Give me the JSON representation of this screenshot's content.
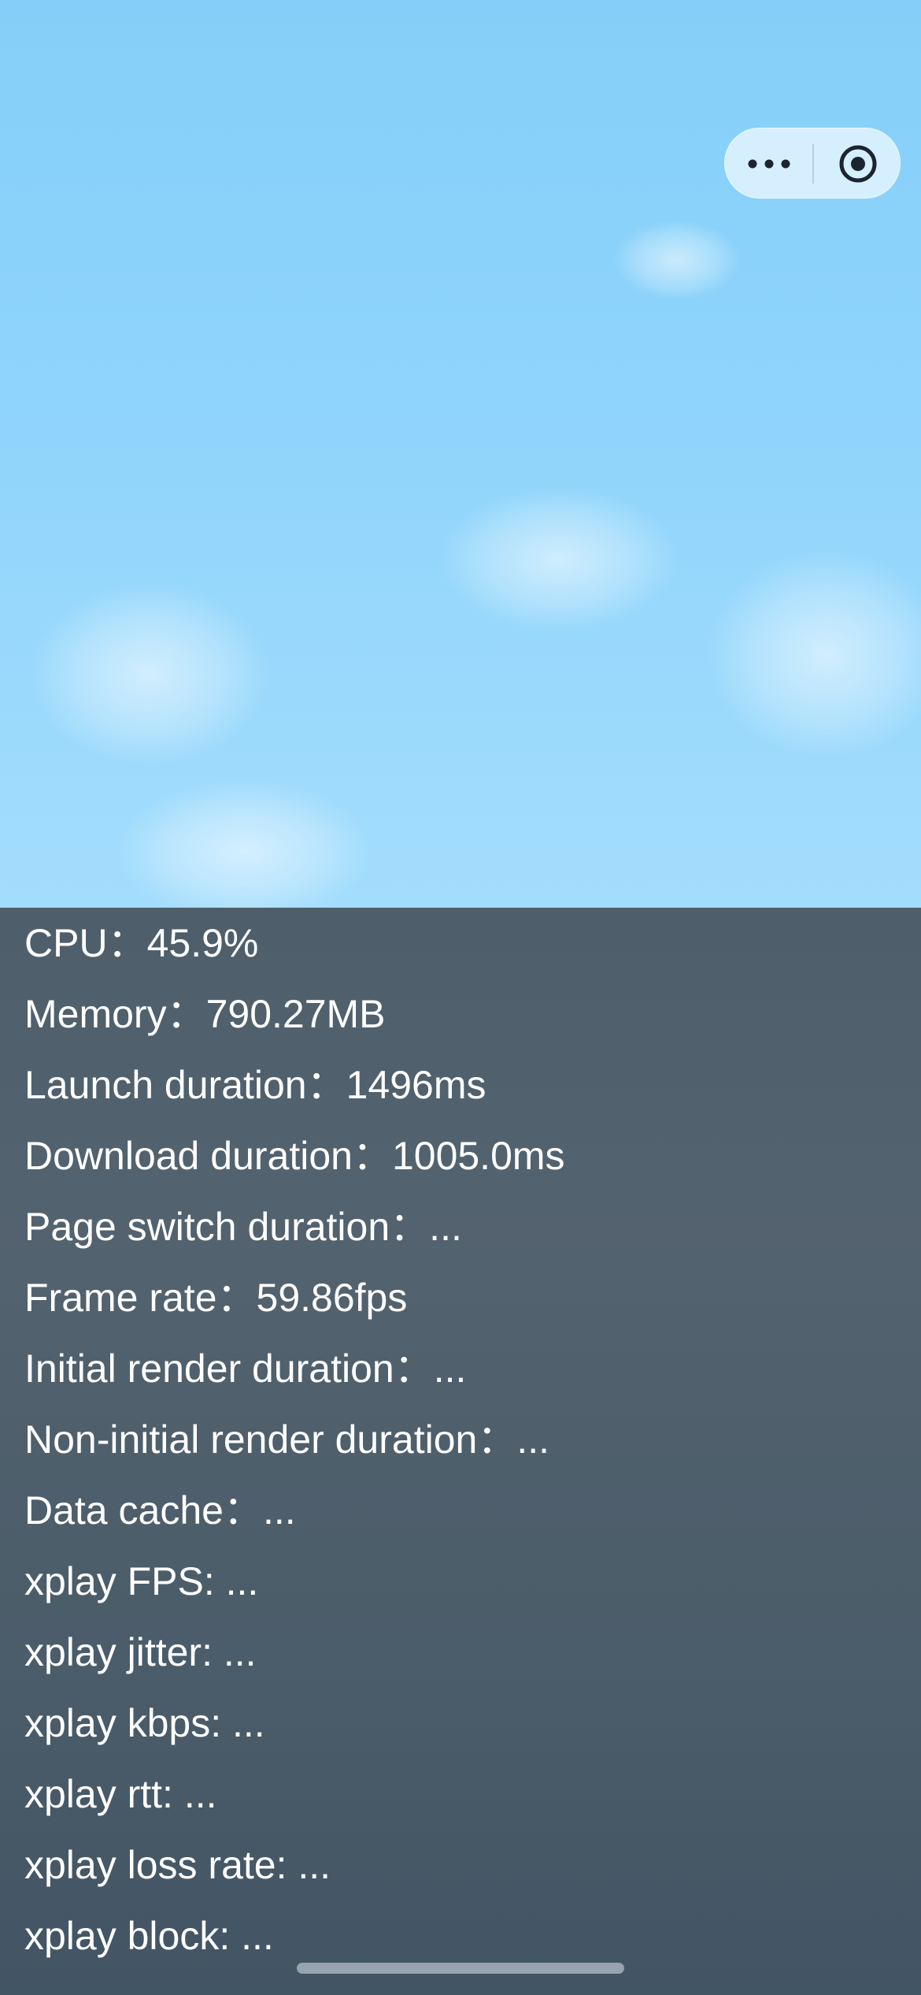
{
  "capsule": {
    "menu_icon": "more-dots-icon",
    "close_icon": "record-circle-icon"
  },
  "stats": [
    {
      "label": "CPU：",
      "value": "45.9%"
    },
    {
      "label": "Memory：",
      "value": "790.27MB"
    },
    {
      "label": "Launch duration：",
      "value": "1496ms"
    },
    {
      "label": "Download duration：",
      "value": "1005.0ms"
    },
    {
      "label": "Page switch duration：",
      "value": "..."
    },
    {
      "label": "Frame rate：",
      "value": "59.86fps"
    },
    {
      "label": "Initial render duration：",
      "value": "..."
    },
    {
      "label": "Non-initial render duration：",
      "value": "..."
    },
    {
      "label": "Data cache：",
      "value": "..."
    },
    {
      "label": "xplay FPS: ",
      "value": "..."
    },
    {
      "label": "xplay jitter: ",
      "value": "..."
    },
    {
      "label": "xplay kbps: ",
      "value": "..."
    },
    {
      "label": "xplay rtt: ",
      "value": "..."
    },
    {
      "label": "xplay loss rate: ",
      "value": "..."
    },
    {
      "label": "xplay block: ",
      "value": "..."
    }
  ],
  "colors": {
    "sky": "#8fd4fb",
    "panel": "#4f5c66",
    "text": "#ffffff"
  }
}
